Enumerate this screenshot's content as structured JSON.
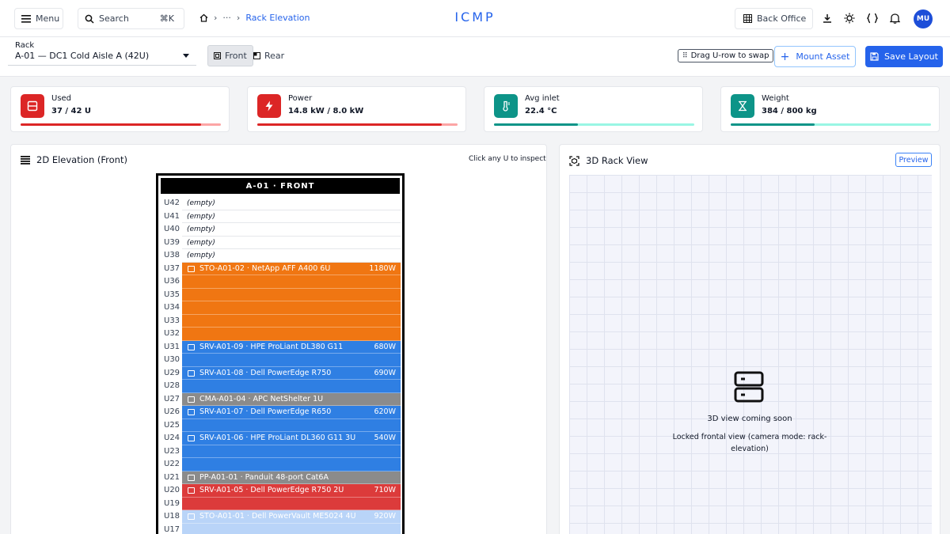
{
  "topbar": {
    "menu_label": "Menu",
    "search_label": "Search",
    "search_shortcut": "⌘K",
    "breadcrumb": {
      "ellipsis": "···",
      "current": "Rack Elevation"
    },
    "brand": "ICMP",
    "backoffice_label": "Back Office",
    "avatar_initials": "MU"
  },
  "toolbar": {
    "rack_label": "Rack",
    "rack_selected": "A-01 — DC1 Cold Aisle A (42U)",
    "view_front": "Front",
    "view_rear": "Rear",
    "drag_hint": "Drag U-row to swap",
    "mount_label": "Mount Asset",
    "save_label": "Save Layout"
  },
  "stats": [
    {
      "label": "Used",
      "value": "37 / 42 U",
      "color": "#dc2626",
      "track": "#fca5a5",
      "fraction": 0.9
    },
    {
      "label": "Power",
      "value": "14.8 kW / 8.0 kW",
      "color": "#dc2626",
      "track": "#fca5a5",
      "fraction": 0.92
    },
    {
      "label": "Avg inlet",
      "value": "22.4 °C",
      "color": "#0d9488",
      "track": "#99f6e4",
      "fraction": 0.42
    },
    {
      "label": "Weight",
      "value": "384 / 800 kg",
      "color": "#0d9488",
      "track": "#99f6e4",
      "fraction": 0.42
    }
  ],
  "elevation": {
    "title": "2D Elevation (Front)",
    "hint": "Click any U to inspect",
    "rack_header": "A-01 · FRONT",
    "empty_text": "(empty)",
    "rows": [
      {
        "u": "U42",
        "type": "empty"
      },
      {
        "u": "U41",
        "type": "empty"
      },
      {
        "u": "U40",
        "type": "empty"
      },
      {
        "u": "U39",
        "type": "empty"
      },
      {
        "u": "U38",
        "type": "empty"
      },
      {
        "u": "U37",
        "type": "storage",
        "color": "#f07612",
        "name": "STO-A01-02 · NetApp AFF A400 6U",
        "power": "1180W"
      },
      {
        "u": "U36",
        "type": "cont",
        "color": "#f07612"
      },
      {
        "u": "U35",
        "type": "cont",
        "color": "#f07612"
      },
      {
        "u": "U34",
        "type": "cont",
        "color": "#f07612"
      },
      {
        "u": "U33",
        "type": "cont",
        "color": "#f07612"
      },
      {
        "u": "U32",
        "type": "cont",
        "color": "#f07612"
      },
      {
        "u": "U31",
        "type": "server",
        "color": "#2f7fe3",
        "name": "SRV-A01-09 · HPE ProLiant DL380 G11",
        "power": "680W"
      },
      {
        "u": "U30",
        "type": "cont",
        "color": "#2f7fe3"
      },
      {
        "u": "U29",
        "type": "server",
        "color": "#2f7fe3",
        "name": "SRV-A01-08 · Dell PowerEdge R750",
        "power": "690W"
      },
      {
        "u": "U28",
        "type": "cont",
        "color": "#2f7fe3"
      },
      {
        "u": "U27",
        "type": "cma",
        "color": "#8b8b8b",
        "name": "CMA-A01-04 · APC NetShelter 1U",
        "power": ""
      },
      {
        "u": "U26",
        "type": "server",
        "color": "#2f7fe3",
        "name": "SRV-A01-07 · Dell PowerEdge R650",
        "power": "620W"
      },
      {
        "u": "U25",
        "type": "cont",
        "color": "#2f7fe3"
      },
      {
        "u": "U24",
        "type": "server",
        "color": "#2f7fe3",
        "name": "SRV-A01-06 · HPE ProLiant DL360 G11 3U",
        "power": "540W"
      },
      {
        "u": "U23",
        "type": "cont",
        "color": "#2f7fe3"
      },
      {
        "u": "U22",
        "type": "cont",
        "color": "#2f7fe3"
      },
      {
        "u": "U21",
        "type": "patch",
        "color": "#8b8b8b",
        "name": "PP-A01-01 · Panduit 48-port Cat6A",
        "power": ""
      },
      {
        "u": "U20",
        "type": "server",
        "color": "#dc3b3b",
        "name": "SRV-A01-05 · Dell PowerEdge R750 2U",
        "power": "710W"
      },
      {
        "u": "U19",
        "type": "cont",
        "color": "#dc3b3b"
      },
      {
        "u": "U18",
        "type": "storage",
        "color": "#b9d4f8",
        "name": "STO-A01-01 · Dell PowerVault ME5024 4U",
        "power": "920W"
      },
      {
        "u": "U17",
        "type": "cont",
        "color": "#b9d4f8"
      }
    ]
  },
  "view3d": {
    "title": "3D Rack View",
    "badge": "Preview",
    "soon_title": "3D view coming soon",
    "soon_sub": "Locked frontal view (camera mode: rack-elevation)"
  }
}
